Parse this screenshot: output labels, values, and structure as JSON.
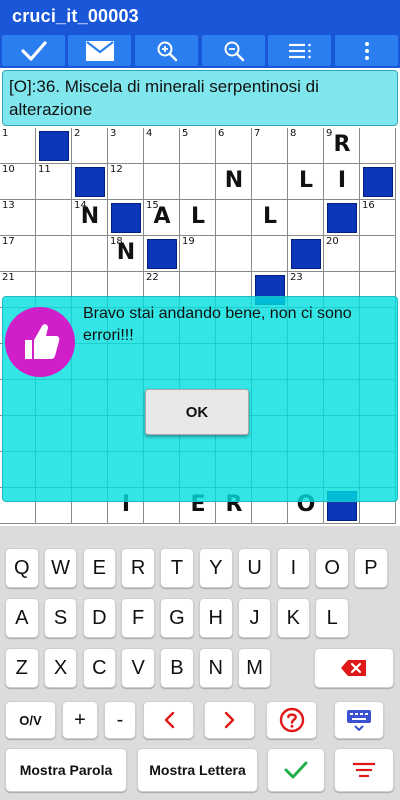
{
  "app": {
    "title": "cruci_it_00003"
  },
  "toolbar": {
    "buttons": [
      {
        "name": "check-icon"
      },
      {
        "name": "mail-icon"
      },
      {
        "name": "zoom-in-icon"
      },
      {
        "name": "zoom-out-icon"
      },
      {
        "name": "list-icon"
      },
      {
        "name": "more-vert-icon"
      }
    ]
  },
  "clue": {
    "text": "[O]:36. Miscela di minerali serpentinosi di alterazione"
  },
  "grid": {
    "rows": [
      [
        {
          "n": "1"
        },
        {
          "b": true
        },
        {
          "n": "2"
        },
        {
          "n": "3"
        },
        {
          "n": "4"
        },
        {
          "n": "5"
        },
        {
          "n": "6"
        },
        {
          "n": "7"
        },
        {
          "n": "8"
        },
        {
          "n": "9",
          "l": "R"
        },
        {}
      ],
      [
        {
          "n": "10"
        },
        {
          "n": "11"
        },
        {
          "b": true
        },
        {
          "n": "12"
        },
        {},
        {},
        {
          "l": "N"
        },
        {},
        {
          "l": "L"
        },
        {
          "l": "I"
        },
        {
          "b": true
        }
      ],
      [
        {
          "n": "13"
        },
        {},
        {
          "n": "14",
          "l": "N"
        },
        {
          "b": true
        },
        {
          "n": "15",
          "l": "A"
        },
        {
          "l": "L"
        },
        {},
        {
          "l": "L"
        },
        {},
        {
          "b": true
        },
        {
          "n": "16"
        }
      ],
      [
        {
          "n": "17"
        },
        {},
        {},
        {
          "n": "18",
          "l": "N"
        },
        {
          "b": true
        },
        {
          "n": "19"
        },
        {},
        {},
        {
          "b": true
        },
        {
          "n": "20"
        },
        {}
      ],
      [
        {
          "n": "21"
        },
        {},
        {},
        {},
        {
          "n": "22"
        },
        {},
        {},
        {
          "b": true
        },
        {
          "n": "23"
        },
        {},
        {}
      ]
    ],
    "bottom_row": [
      {},
      {},
      {},
      {
        "l": "I"
      },
      {},
      {
        "l": "E"
      },
      {
        "l": "R"
      },
      {},
      {
        "l": "O"
      },
      {
        "b": true
      },
      {}
    ]
  },
  "dialog": {
    "message": "Bravo stai andando bene, non ci sono errori!!!",
    "ok_label": "OK",
    "icon": "thumbs-up-icon"
  },
  "keyboard": {
    "row1": [
      "Q",
      "W",
      "E",
      "R",
      "T",
      "Y",
      "U",
      "I",
      "O",
      "P"
    ],
    "row2": [
      "A",
      "S",
      "D",
      "F",
      "G",
      "H",
      "J",
      "K",
      "L"
    ],
    "row3": [
      "Z",
      "X",
      "C",
      "V",
      "B",
      "N",
      "M"
    ],
    "row4": {
      "ov": "O/V",
      "plus": "+",
      "minus": "-"
    },
    "row5": {
      "show_word": "Mostra Parola",
      "show_letter": "Mostra Lettera"
    }
  },
  "colors": {
    "toolbar_bg": "#1a56d8",
    "toolbar_button": "#2a7ef0",
    "clue_bg": "#7fe6ee",
    "black_cell": "#0e36b8",
    "dialog_bg": "#00dede",
    "accent_red": "#e01818",
    "accent_green": "#22b04a"
  }
}
